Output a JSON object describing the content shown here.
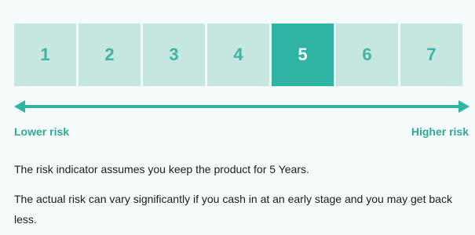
{
  "colors": {
    "accent": "#2fb3a2",
    "box_light": "#c6e6e0",
    "number": "#3fb3a5",
    "number_selected": "#ffffff",
    "label": "#2fa898"
  },
  "risk_scale": {
    "levels": [
      {
        "label": "1",
        "selected": false
      },
      {
        "label": "2",
        "selected": false
      },
      {
        "label": "3",
        "selected": false
      },
      {
        "label": "4",
        "selected": false
      },
      {
        "label": "5",
        "selected": true
      },
      {
        "label": "6",
        "selected": false
      },
      {
        "label": "7",
        "selected": false
      }
    ],
    "lower_label": "Lower risk",
    "higher_label": "Higher risk"
  },
  "text": {
    "line1": "The risk indicator assumes you keep the product for 5 Years.",
    "line2": "The actual risk can vary significantly if you cash in at an early stage and you may get back less."
  }
}
